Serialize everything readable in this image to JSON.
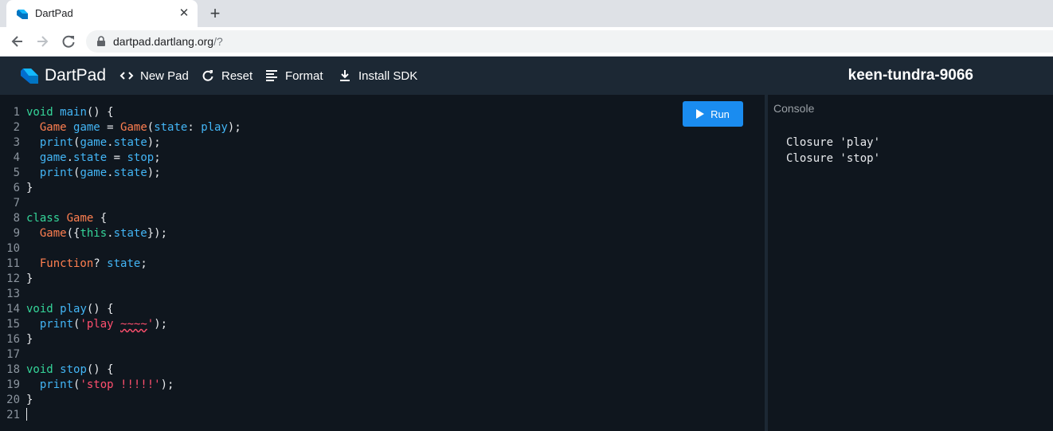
{
  "browser": {
    "tab_title": "DartPad",
    "url_host": "dartpad.dartlang.org",
    "url_path": "/?"
  },
  "header": {
    "brand": "DartPad",
    "buttons": {
      "new_pad": "New Pad",
      "reset": "Reset",
      "format": "Format",
      "install_sdk": "Install SDK"
    },
    "pad_name": "keen-tundra-9066"
  },
  "editor": {
    "run_label": "Run",
    "line_numbers": [
      "1",
      "2",
      "3",
      "4",
      "5",
      "6",
      "7",
      "8",
      "9",
      "10",
      "11",
      "12",
      "13",
      "14",
      "15",
      "16",
      "17",
      "18",
      "19",
      "20",
      "21"
    ],
    "tokens": {
      "l1": [
        "void ",
        "main",
        "() {"
      ],
      "l2": [
        "  ",
        "Game",
        " ",
        "game",
        " = ",
        "Game",
        "(",
        "state",
        ": ",
        "play",
        ");"
      ],
      "l3": [
        "  ",
        "print",
        "(",
        "game",
        ".",
        "state",
        ");"
      ],
      "l4": [
        "  ",
        "game",
        ".",
        "state",
        " = ",
        "stop",
        ";"
      ],
      "l5": [
        "  ",
        "print",
        "(",
        "game",
        ".",
        "state",
        ");"
      ],
      "l6": [
        "}"
      ],
      "l8": [
        "class",
        " ",
        "Game",
        " {"
      ],
      "l9": [
        "  ",
        "Game",
        "({",
        "this",
        ".",
        "state",
        "});"
      ],
      "l11": [
        "  ",
        "Function",
        "? ",
        "state",
        ";"
      ],
      "l12": [
        "}"
      ],
      "l14": [
        "void ",
        "play",
        "() {"
      ],
      "l15": [
        "  ",
        "print",
        "(",
        "'play ",
        "~~~~",
        "'",
        ");"
      ],
      "l16": [
        "}"
      ],
      "l18": [
        "void ",
        "stop",
        "() {"
      ],
      "l19": [
        "  ",
        "print",
        "(",
        "'stop !!!!!'",
        ");"
      ],
      "l20": [
        "}"
      ]
    }
  },
  "console": {
    "title": "Console",
    "output": [
      "Closure 'play'",
      "Closure 'stop'"
    ]
  },
  "colors": {
    "header_bg": "#1c2834",
    "editor_bg": "#0f161e",
    "run_button": "#1a8cf0",
    "keyword": "#35d69a",
    "type": "#ff7f50",
    "identifier": "#43b5f5",
    "string": "#ff4f6e"
  }
}
